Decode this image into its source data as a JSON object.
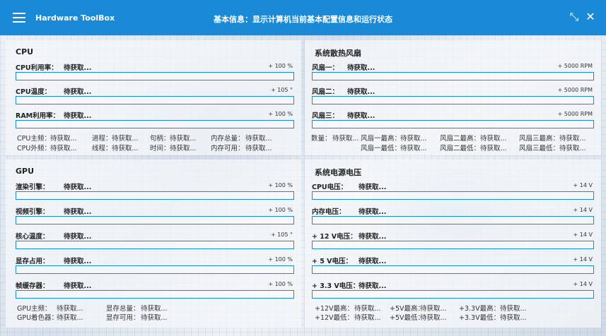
{
  "header": {
    "app_title": "Hardware ToolBox",
    "window_title": "基本信息：显示计算机当前基本配置信息和运行状态"
  },
  "cpu": {
    "title": "CPU",
    "rows": [
      {
        "label": "CPU利用率：",
        "value": "待获取...",
        "max": "+ 100 %"
      },
      {
        "label": "CPU温度：",
        "value": "待获取...",
        "max": "+ 105 °"
      },
      {
        "label": "RAM利用率：",
        "value": "待获取...",
        "max": "+ 100 %"
      }
    ],
    "info": [
      [
        "CPU主频：",
        "待获取...",
        "进程：",
        "待获取...",
        "句柄：",
        "待获取...",
        "内存总量：",
        "待获取..."
      ],
      [
        "CPU外频：",
        "待获取...",
        "线程：",
        "待获取...",
        "时间：",
        "待获取...",
        "内存可用：",
        "待获取..."
      ]
    ]
  },
  "fans": {
    "title": "系统散热风扇",
    "rows": [
      {
        "label": "风扇一：",
        "value": "待获取...",
        "max": "+ 5000 RPM"
      },
      {
        "label": "风扇二：",
        "value": "待获取...",
        "max": "+ 5000 RPM"
      },
      {
        "label": "风扇三：",
        "value": "待获取...",
        "max": "+ 5000 RPM"
      }
    ],
    "info": [
      [
        "数量：",
        "待获取...",
        "风扇一最高：",
        "待获取...",
        "风扇二最高：",
        "待获取...",
        "风扇三最高：",
        "待获取..."
      ],
      [
        "",
        "",
        "风扇一最低：",
        "待获取...",
        "风扇二最低：",
        "待获取...",
        "风扇三最低：",
        "待获取..."
      ]
    ]
  },
  "gpu": {
    "title": "GPU",
    "rows": [
      {
        "label": "渲染引擎：",
        "value": "待获取...",
        "max": "+ 100 %"
      },
      {
        "label": "视频引擎：",
        "value": "待获取...",
        "max": "+ 100 %"
      },
      {
        "label": "核心温度：",
        "value": "待获取...",
        "max": "+ 105 °"
      },
      {
        "label": "显存占用：",
        "value": "待获取...",
        "max": "+ 100 %"
      },
      {
        "label": "帧缓存器：",
        "value": "待获取...",
        "max": "+ 100 %"
      }
    ],
    "info": [
      [
        "GPU主频：",
        "待获取...",
        "显存总量：",
        "待获取..."
      ],
      [
        "GPU着色器：",
        "待获取...",
        "显存可用：",
        "待获取..."
      ]
    ]
  },
  "voltage": {
    "title": "系统电源电压",
    "rows": [
      {
        "label": "CPU电压：",
        "value": "待获取...",
        "max": "+ 14 V"
      },
      {
        "label": "内存电压：",
        "value": "待获取...",
        "max": "+ 14 V"
      },
      {
        "label": "+ 12 V电压：",
        "value": "待获取...",
        "max": "+ 14 V"
      },
      {
        "label": "+ 5 V电压：",
        "value": "待获取...",
        "max": "+ 14 V"
      },
      {
        "label": "+ 3.3 V电压：",
        "value": "待获取...",
        "max": "+ 14 V"
      }
    ],
    "info": [
      [
        "+12V最高：",
        "待获取...",
        "+5V最高：",
        "待获取...",
        "+3.3V最高：",
        "待获取..."
      ],
      [
        "+12V最低：",
        "待获取...",
        "+5V最低：",
        "待获取...",
        "+3.3V最低：",
        "待获取..."
      ]
    ]
  }
}
